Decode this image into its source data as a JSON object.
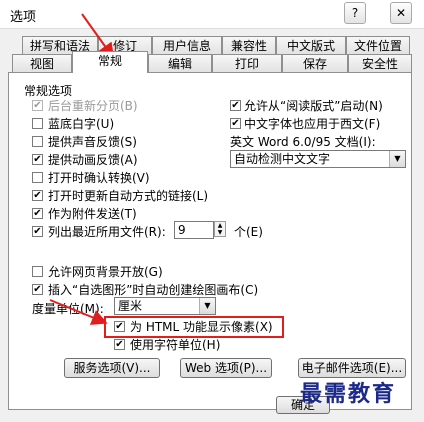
{
  "window": {
    "title": "选项",
    "help_label": "?",
    "close_label": "✕"
  },
  "tabs_row1": [
    "拼写和语法",
    "修订",
    "用户信息",
    "兼容性",
    "中文版式",
    "文件位置"
  ],
  "tabs_row2": [
    "视图",
    "常规",
    "编辑",
    "打印",
    "保存",
    "安全性"
  ],
  "active_tab": "常规",
  "section_title": "常规选项",
  "left_options": [
    {
      "label": "后台重新分页(B)",
      "checked": true,
      "disabled": true
    },
    {
      "label": "蓝底白字(U)",
      "checked": false,
      "disabled": false
    },
    {
      "label": "提供声音反馈(S)",
      "checked": false,
      "disabled": false
    },
    {
      "label": "提供动画反馈(A)",
      "checked": true,
      "disabled": false
    },
    {
      "label": "打开时确认转换(V)",
      "checked": false,
      "disabled": false
    },
    {
      "label": "打开时更新自动方式的链接(L)",
      "checked": true,
      "disabled": false
    },
    {
      "label": "作为附件发送(T)",
      "checked": true,
      "disabled": false
    },
    {
      "label": "列出最近所用文件(R):",
      "checked": true,
      "disabled": false
    }
  ],
  "recent_files": {
    "value": "9",
    "unit": "个(E)"
  },
  "right_options": [
    {
      "label": "允许从“阅读版式”启动(N)",
      "checked": true
    },
    {
      "label": "中文字体也应用于西文(F)",
      "checked": true
    }
  ],
  "english_doc": {
    "label": "英文 Word 6.0/95 文档(I):",
    "value": "自动检测中文文字"
  },
  "lower_options": [
    {
      "label": "允许网页背景开放(G)",
      "checked": false
    },
    {
      "label": "插入“自选图形”时自动创建绘图画布(C)",
      "checked": true
    }
  ],
  "measure_unit": {
    "label": "度量单位(M):",
    "value": "厘米"
  },
  "html_pixels": {
    "label": "为 HTML 功能显示像素(X)",
    "checked": true
  },
  "char_unit": {
    "label": "使用字符单位(H)",
    "checked": true
  },
  "buttons": {
    "service": "服务选项(V)...",
    "web": "Web 选项(P)...",
    "email": "电子邮件选项(E)...",
    "ok": "确定"
  },
  "watermark": "最需教育",
  "colors": {
    "annotation": "#e01e1e",
    "watermark": "#1b2a8a"
  }
}
